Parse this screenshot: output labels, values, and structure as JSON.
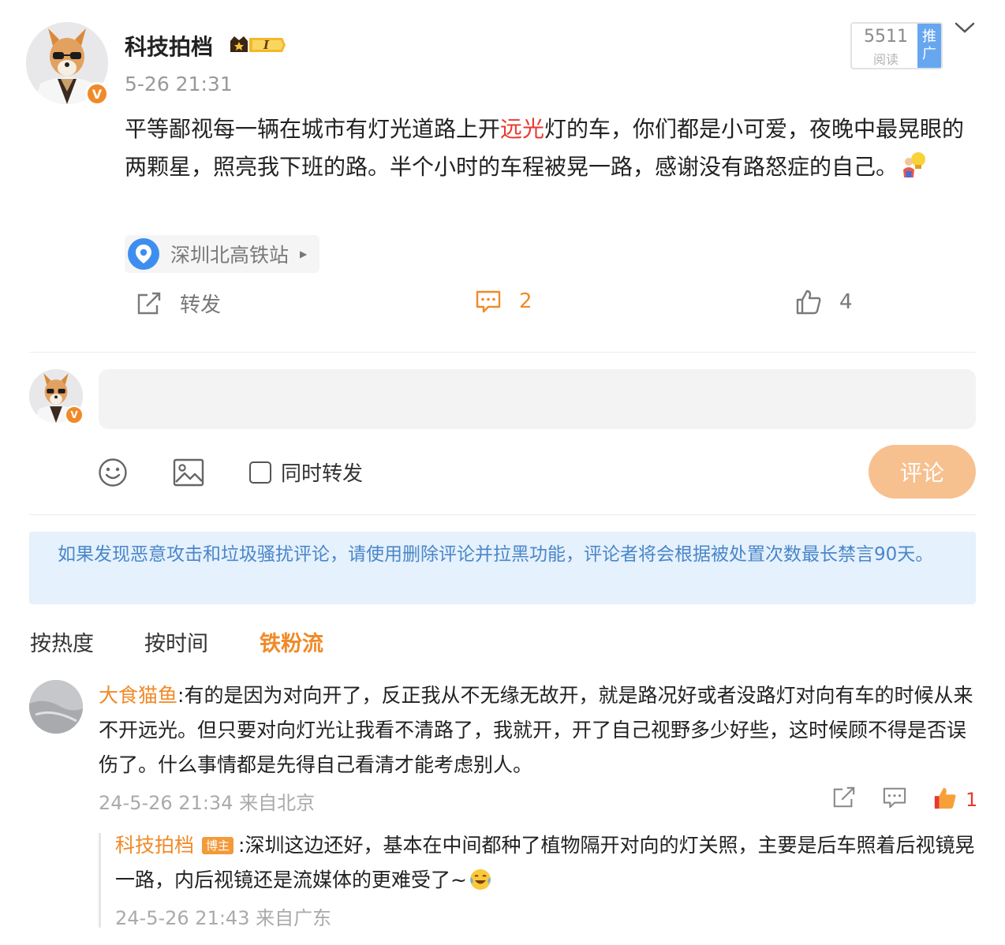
{
  "post": {
    "author": "科技拍档",
    "vip_icon": "crown-vip-badge",
    "vip_level": "I",
    "verified_icon": "verified-v-icon",
    "verified_mark": "V",
    "time": "5-26 21:31",
    "read_count": "5511",
    "read_label": "阅读",
    "promote_label": "推广",
    "text_before": "平等鄙视每一辆在城市有灯光道路上开",
    "text_highlight": "远光",
    "text_after": "灯的车，你们都是小可爱，夜晚中最晃眼的两颗星，照亮我下班的路。半个小时的车程被晃一路，感谢没有路怒症的自己。",
    "emoji_icon": "lightbulb-person-emoji",
    "location": "深圳北高铁站",
    "actions": {
      "repost_label": "转发",
      "comment_count": "2",
      "like_count": "4"
    }
  },
  "composer": {
    "placeholder": "",
    "sync_repost_label": "同时转发",
    "submit_label": "评论"
  },
  "notice": "如果发现恶意攻击和垃圾骚扰评论，请使用删除评论并拉黑功能，评论者将会根据被处置次数最长禁言90天。",
  "sort_tabs": [
    "按热度",
    "按时间",
    "铁粉流"
  ],
  "comment": {
    "user": "大食猫鱼",
    "text": ":有的是因为对向开了，反正我从不无缘无故开，就是路况好或者没路灯对向有车的时候从来不开远光。但只要对向灯光让我看不清路了，我就开，开了自己视野多少好些，这时候顾不得是否误伤了。什么事情都是先得自己看清才能考虑别人。",
    "meta": "24-5-26 21:34 来自北京",
    "like_count": "1",
    "reply": {
      "user": "科技拍档",
      "badge": "博主",
      "text": ":深圳这边还好，基本在中间都种了植物隔开对向的灯关照，主要是后车照着后视镜晃一路，内后视镜还是流媒体的更难受了~",
      "meta": "24-5-26 21:43 来自广东"
    }
  },
  "colors": {
    "accent": "#f08a28",
    "highlight": "#e8392f",
    "notice_bg": "#e5f1fc",
    "notice_text": "#4a86c9",
    "location_pin": "#3e8ef0"
  }
}
